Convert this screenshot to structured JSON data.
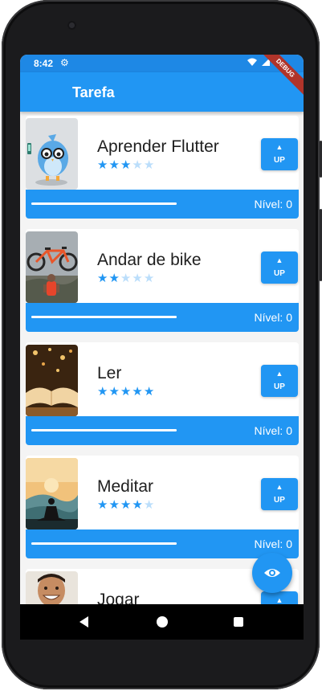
{
  "status_bar": {
    "time": "8:42"
  },
  "app_bar": {
    "title": "Tarefa"
  },
  "debug_banner": {
    "label": "DEBUG"
  },
  "colors": {
    "primary": "#2196f3",
    "star_on": "#2196f3",
    "star_off": "#bbdefb",
    "card_bg": "#ffffff"
  },
  "icons": {
    "status_settings": "gear-icon",
    "status_wifi": "wifi-icon",
    "status_signal": "signal-icon",
    "status_battery": "battery-icon",
    "up_arrow": "arrow-up-icon",
    "fab": "eye-icon"
  },
  "tasks": [
    {
      "name": "Aprender Flutter",
      "rating": 3,
      "max_rating": 5,
      "up_label": "UP",
      "level_text": "Nível: 0",
      "progress": 1.0
    },
    {
      "name": "Andar de bike",
      "rating": 2,
      "max_rating": 5,
      "up_label": "UP",
      "level_text": "Nível: 0",
      "progress": 1.0
    },
    {
      "name": "Ler",
      "rating": 5,
      "max_rating": 5,
      "up_label": "UP",
      "level_text": "Nível: 0",
      "progress": 1.0
    },
    {
      "name": "Meditar",
      "rating": 4,
      "max_rating": 5,
      "up_label": "UP",
      "level_text": "Nível: 0",
      "progress": 1.0
    },
    {
      "name": "Jogar",
      "rating": 0,
      "max_rating": 5,
      "up_label": "UP",
      "level_text": "",
      "progress": 1.0
    }
  ]
}
